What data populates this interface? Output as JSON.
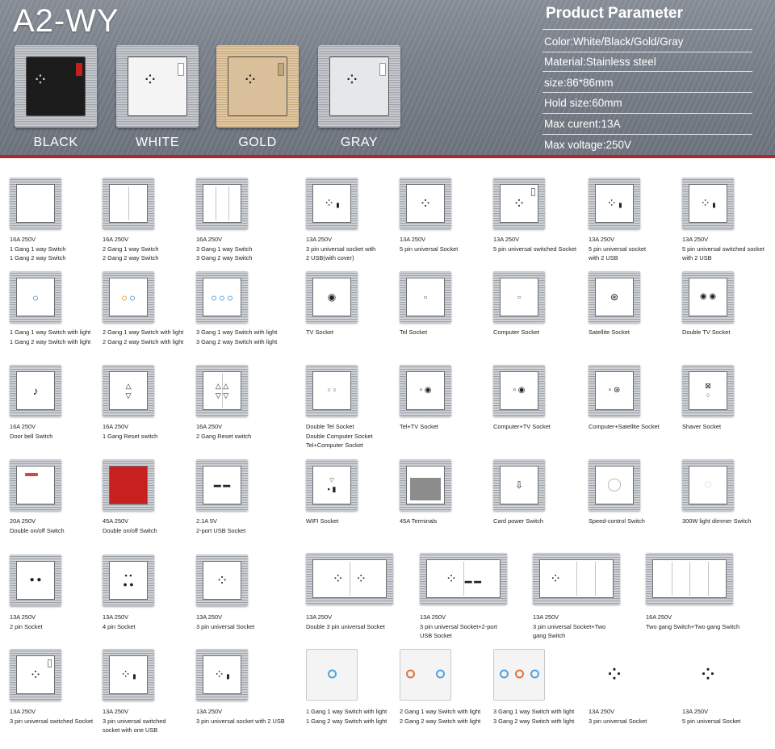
{
  "header": {
    "model": "A2-WY",
    "variants": [
      {
        "label": "BLACK",
        "face_color": "#1c1c1c",
        "glyph_color": "#cfcfcf"
      },
      {
        "label": "WHITE",
        "face_color": "#f4f4f4",
        "glyph_color": "#222222"
      },
      {
        "label": "GOLD",
        "face_color": "#d9c09a",
        "glyph_color": "#222222"
      },
      {
        "label": "GRAY",
        "face_color": "#e6e7e9",
        "glyph_color": "#222222"
      }
    ],
    "param_title": "Product Parameter",
    "params": [
      "Color:White/Black/Gold/Gray",
      "Material:Stainless steel",
      "size:86*86mm",
      "Hold size:60mm",
      "Max curent:13A",
      "Max voltage:250V"
    ]
  },
  "colors": {
    "accent": "#b3262a",
    "led_blue": "#4ea3dd",
    "led_orange": "#e2733a",
    "red_switch": "#c8201e"
  },
  "rows": [
    [
      {
        "icon": "one-gang-switch-icon",
        "lines": [
          "16A 250V",
          "1 Gang 1 way Switch",
          "1 Gang 2 way Switch"
        ]
      },
      {
        "icon": "two-gang-switch-icon",
        "lines": [
          "16A 250V",
          "2 Gang 1 way Switch",
          "2 Gang 2 way Switch"
        ]
      },
      {
        "icon": "three-gang-switch-icon",
        "lines": [
          "16A 250V",
          "3 Gang 1 way Switch",
          "3 Gang 2 way Switch"
        ]
      },
      {
        "icon": "universal-socket-usb-cover-icon",
        "lines": [
          "13A 250V",
          "3 pin universal socket with",
          "2 USB(with cover)"
        ]
      },
      {
        "icon": "five-pin-socket-icon",
        "lines": [
          "13A 250V",
          "5 pin universal Socket"
        ]
      },
      {
        "icon": "five-pin-switched-socket-icon",
        "lines": [
          "13A 250V",
          "5 pin universal switched Socket"
        ]
      },
      {
        "icon": "five-pin-socket-usb-icon",
        "lines": [
          "13A 250V",
          "5 pin universal socket",
          "with 2 USB"
        ]
      },
      {
        "icon": "five-pin-switched-socket-usb-icon",
        "lines": [
          "13A 250V",
          "5 pin universal switched socket",
          "with 2 USB"
        ]
      }
    ],
    [
      {
        "icon": "one-gang-light-switch-icon",
        "lines": [
          "1 Gang 1 way Switch with light",
          "1 Gang 2 way Switch with light"
        ]
      },
      {
        "icon": "two-gang-light-switch-icon",
        "lines": [
          "2 Gang 1 way Switch with light",
          "2 Gang 2 way Switch with light"
        ]
      },
      {
        "icon": "three-gang-light-switch-icon",
        "lines": [
          "3 Gang 1 way Switch with light",
          "3 Gang 2 way Switch with light"
        ]
      },
      {
        "icon": "tv-socket-icon",
        "lines": [
          "TV Socket"
        ]
      },
      {
        "icon": "tel-socket-icon",
        "lines": [
          "Tel Socket"
        ]
      },
      {
        "icon": "computer-socket-icon",
        "lines": [
          "Computer Socket"
        ]
      },
      {
        "icon": "satellite-socket-icon",
        "lines": [
          "Satellite Socket"
        ]
      },
      {
        "icon": "double-tv-socket-icon",
        "lines": [
          "Double TV Socket"
        ]
      }
    ],
    [
      {
        "icon": "door-bell-icon",
        "lines": [
          "16A 250V",
          "Door bell Switch"
        ]
      },
      {
        "icon": "one-gang-reset-icon",
        "lines": [
          "16A 250V",
          "1 Gang Reset switch"
        ]
      },
      {
        "icon": "two-gang-reset-icon",
        "lines": [
          "16A 250V",
          "2 Gang Reset switch"
        ]
      },
      {
        "icon": "double-tel-socket-icon",
        "lines": [
          "Double Tel Socket",
          "Double Computer Socket",
          "Tel+Computer Socket"
        ]
      },
      {
        "icon": "tel-tv-socket-icon",
        "lines": [
          "Tel+TV Socket"
        ]
      },
      {
        "icon": "computer-tv-socket-icon",
        "lines": [
          "Computer+TV Socket"
        ]
      },
      {
        "icon": "computer-satellite-socket-icon",
        "lines": [
          "Computer+Satellite Socket"
        ]
      },
      {
        "icon": "shaver-socket-icon",
        "lines": [
          "Shaver Socket"
        ]
      }
    ],
    [
      {
        "icon": "double-onoff-20a-icon",
        "lines": [
          "20A 250V",
          "Double on/off Switch"
        ]
      },
      {
        "icon": "double-onoff-45a-icon",
        "lines": [
          "45A 250V",
          "Double on/off Switch"
        ]
      },
      {
        "icon": "two-port-usb-icon",
        "lines": [
          "2.1A 5V",
          "2-port USB Socket"
        ]
      },
      {
        "icon": "wifi-socket-icon",
        "lines": [
          "WIFI Socket"
        ]
      },
      {
        "icon": "terminals-icon",
        "lines": [
          "45A Terminals"
        ]
      },
      {
        "icon": "card-power-switch-icon",
        "lines": [
          "Card power Switch"
        ]
      },
      {
        "icon": "speed-control-icon",
        "lines": [
          "Speed-control Switch"
        ]
      },
      {
        "icon": "dimmer-icon",
        "lines": [
          "300W light dimmer Switch"
        ]
      }
    ],
    [
      {
        "icon": "two-pin-socket-icon",
        "lines": [
          "13A 250V",
          "2 pin Socket"
        ]
      },
      {
        "icon": "four-pin-socket-icon",
        "lines": [
          "13A 250V",
          "4 pin Socket"
        ]
      },
      {
        "icon": "three-pin-socket-icon",
        "lines": [
          "13A 250V",
          "3 pin universal Socket"
        ]
      },
      {
        "icon": "double-three-pin-socket-icon",
        "lines": [
          "13A 250V",
          "Double 3 pin universal Socket"
        ]
      },
      {
        "icon": "socket-usb-combo-icon",
        "lines": [
          "13A 250V",
          "3 pin universal Socket+2-port",
          "USB Socket"
        ]
      },
      {
        "icon": "socket-two-gang-switch-icon",
        "lines": [
          "13A 250V",
          "3 pin universal Socket+Two",
          "gang Switch"
        ]
      },
      {
        "icon": "two-gang-two-gang-switch-icon",
        "lines": [
          "16A 250V",
          "Two gang Switch+Two gang Switch"
        ]
      }
    ],
    [
      {
        "icon": "three-pin-switched-socket-icon",
        "lines": [
          "13A 250V",
          "3 pin universal switched Socket"
        ]
      },
      {
        "icon": "three-pin-switched-one-usb-icon",
        "lines": [
          "13A 250V",
          "3 pin universal switched",
          "socket with one USB"
        ]
      },
      {
        "icon": "three-pin-socket-two-usb-icon",
        "lines": [
          "13A 250V",
          "3 pin universal socket with 2 USB"
        ]
      },
      {
        "icon": "one-gang-glass-switch-icon",
        "lines": [
          "1 Gang 1 way Switch with light",
          "1 Gang 2 way Switch with light"
        ]
      },
      {
        "icon": "two-gang-glass-switch-icon",
        "lines": [
          "2 Gang 1 way Switch with light",
          "2 Gang 2 way Switch with light"
        ]
      },
      {
        "icon": "three-gang-glass-switch-icon",
        "lines": [
          "3 Gang 1 way Switch with light",
          "3 Gang 2 way Switch with light"
        ]
      },
      {
        "icon": "three-pin-module-icon",
        "lines": [
          "13A 250V",
          "3 pin universal Socket"
        ]
      },
      {
        "icon": "five-pin-module-icon",
        "lines": [
          "13A 250V",
          "5 pin universal Socket"
        ]
      }
    ]
  ]
}
